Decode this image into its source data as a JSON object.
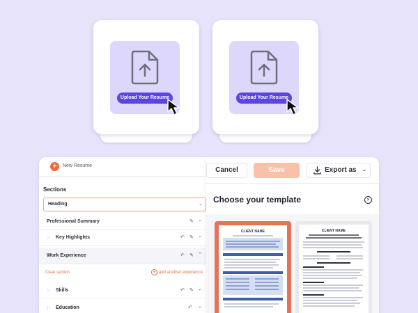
{
  "upload_cards": [
    {
      "button_label": "Upload Your Resume"
    },
    {
      "button_label": "Upload Your Resume"
    }
  ],
  "editor": {
    "new_resume": "New Resume",
    "sections_title": "Sections",
    "heading": "Heading",
    "professional_summary": "Professional Summary",
    "key_highlights": "Key Highlights",
    "work_experience": "Work Experience",
    "clear_section": "Clear section",
    "add_experience": "add another experience",
    "skills": "Skills",
    "education": "Education"
  },
  "toolbar": {
    "cancel": "Cancel",
    "save": "Save",
    "export": "Export as"
  },
  "templates": {
    "title": "Choose your template",
    "client_name": "CLIENT NAME",
    "items": [
      {
        "client_name": "CLIENT NAME",
        "accent": "#e5735a"
      },
      {
        "client_name": "CLIENT NAME",
        "accent": "#e9e9ec"
      }
    ]
  },
  "colors": {
    "background": "#e6e3fb",
    "primary": "#5b45e0",
    "accent": "#f26a3d",
    "save_disabled": "#f9c1a9"
  },
  "icons": [
    "file-upload-icon",
    "cursor-icon",
    "plus-icon",
    "edit-icon",
    "undo-icon",
    "chevron-down-icon",
    "chevron-up-icon",
    "drag-handle-icon",
    "download-icon",
    "close-icon"
  ]
}
